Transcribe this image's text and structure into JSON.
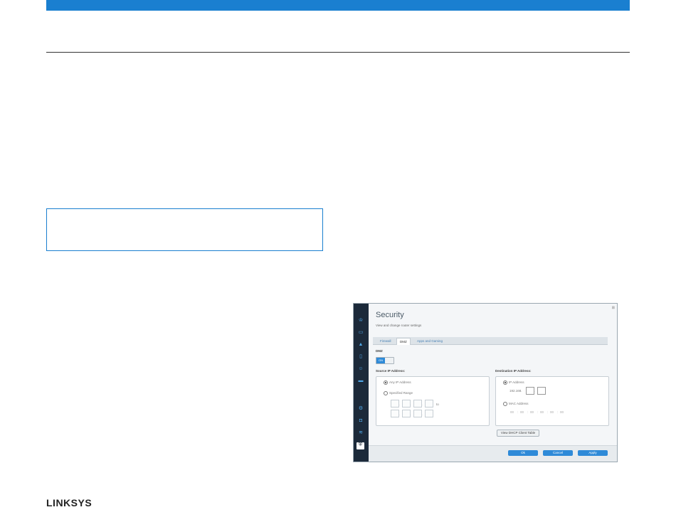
{
  "brand": {
    "logo_text": "LINKSYS",
    "accent": "#1a7fd0"
  },
  "screenshot": {
    "title": "Security",
    "subtitle": "View and change router settings",
    "close_icon": "close-icon",
    "tabs": [
      {
        "label": "Firewall"
      },
      {
        "label": "DMZ"
      },
      {
        "label": "Apps and Gaming"
      }
    ],
    "dmz": {
      "label": "DMZ",
      "toggle_on_label": "ON"
    },
    "source": {
      "label": "Source IP Address:",
      "any_label": "Any IP Address",
      "range_label": "Specified Range",
      "to_label": "to"
    },
    "destination": {
      "label": "Destination IP Address:",
      "ip_label": "IP Address",
      "ip_prefix": "192.168.",
      "ip_sep": ".",
      "mac_label": "MAC Address",
      "mac_values": [
        "00",
        "00",
        "00",
        "00",
        "00",
        "00"
      ],
      "mac_sep": ":",
      "dhcp_button": "View DHCP Client Table"
    },
    "range_sep": ".",
    "footer": {
      "ok": "Ok",
      "cancel": "Cancel",
      "apply": "Apply"
    }
  }
}
